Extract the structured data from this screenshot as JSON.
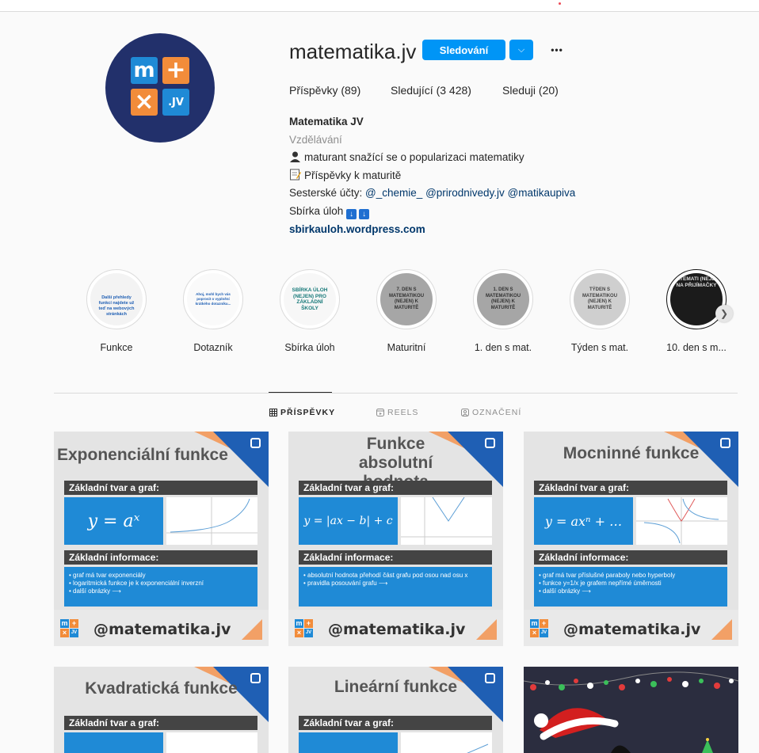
{
  "profile": {
    "username": "matematika.jv",
    "follow_label": "Sledování",
    "more_label": "•••",
    "stats": [
      {
        "label": "Příspěvky (89)"
      },
      {
        "label": "Sledující (3 428)"
      },
      {
        "label": "Sleduji (20)"
      }
    ],
    "bio": {
      "name": "Matematika JV",
      "category": "Vzdělávání",
      "line1": "maturant snažící se o popularizaci matematiky",
      "line2": "Příspěvky k maturitě",
      "line3_prefix": "Sesterské účty: ",
      "mentions": [
        "@_chemie_",
        "@prirodnivedy.jv",
        "@matikaupiva"
      ],
      "line4": "Sbírka úloh",
      "link": "sbirkauloh.wordpress.com"
    },
    "avatar_tiles": [
      "m",
      "+",
      "×",
      ".JV"
    ]
  },
  "highlights": [
    {
      "label": "Funkce",
      "cover": "Další přehledy funkcí najdete už teď na webových stránkách"
    },
    {
      "label": "Dotazník",
      "cover": "Ahoj, mohl bych vás poprosit o vyplnění krátkého dotazníku..."
    },
    {
      "label": "Sbírka úloh",
      "cover": "SBÍRKA ÚLOH (NEJEN) PRO ZÁKLADNÍ ŠKOLY"
    },
    {
      "label": "Maturitní",
      "cover": "7. DEN S MATEMATIKOU (NEJEN) K MATURITĚ"
    },
    {
      "label": "1. den s mat.",
      "cover": "1. DEN S MATEMATIKOU (NEJEN) K MATURITĚ"
    },
    {
      "label": "Týden s mat.",
      "cover": "TÝDEN S MATEMATIKOU (NEJEN) K MATURITĚ"
    },
    {
      "label": "10. den s m...",
      "cover": "MATEMATI (NEJEN) NA PŘIJÍMAČKY"
    }
  ],
  "tabs": [
    {
      "label": "PŘÍSPĚVKY"
    },
    {
      "label": "REELS"
    },
    {
      "label": "OZNAČENÍ"
    }
  ],
  "posts": [
    {
      "title": "Exponenciální funkce",
      "bar1": "Základní tvar a graf:",
      "formula": "y = aˣ",
      "bar2": "Základní informace:",
      "info": [
        "• graf má tvar exponenciály",
        "• logaritmická funkce je k exponenciální inverzní",
        "• další obrázky ⟶"
      ],
      "handle": "@matematika.jv"
    },
    {
      "title": "Funkce absolutní hodnota",
      "bar1": "Základní tvar a graf:",
      "formula": "y = |ax − b| + c",
      "bar2": "Základní informace:",
      "info": [
        "• absolutní hodnota přehodí část grafu pod osou nad osu x",
        "• pravidla posouvání grafu ⟶"
      ],
      "handle": "@matematika.jv"
    },
    {
      "title": "Mocninné funkce",
      "bar1": "Základní tvar a graf:",
      "formula": "y = axⁿ + …",
      "bar2": "Základní informace:",
      "info": [
        "• graf má tvar příslušné paraboly nebo hyperboly",
        "• funkce y=1/x je grafem nepřímé úměrnosti",
        "• další obrázky ⟶"
      ],
      "handle": "@matematika.jv"
    },
    {
      "title": "Kvadratická funkce",
      "bar1": "Základní tvar a graf:"
    },
    {
      "title": "Lineární funkce",
      "bar1": "Základní tvar a graf:"
    }
  ],
  "colors": {
    "accent": "#0095f6",
    "brand_blue": "#1f8ad6",
    "brand_orange": "#f2a066",
    "avatar_bg": "#22306b"
  }
}
